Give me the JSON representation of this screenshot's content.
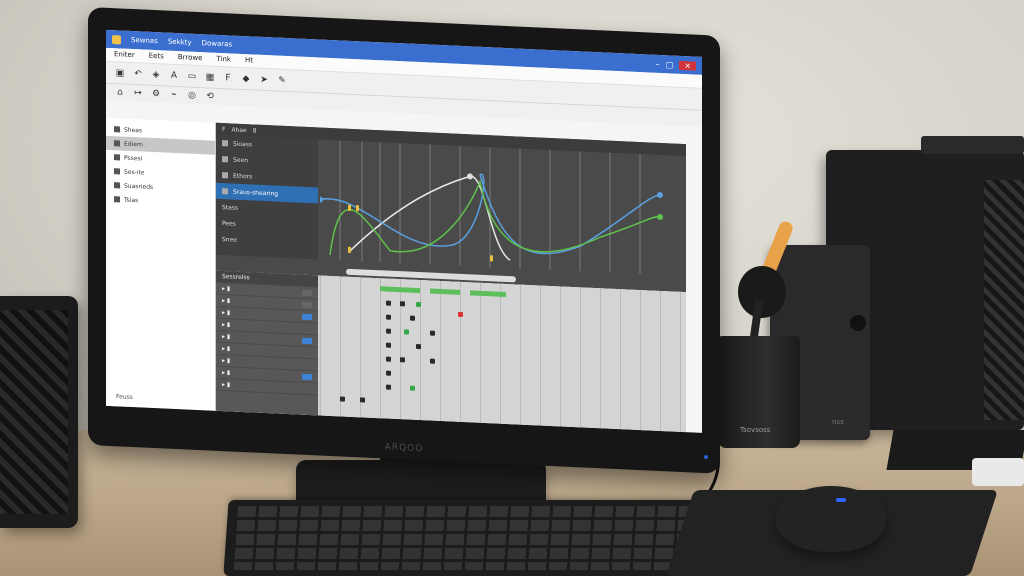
{
  "app": {
    "title_items": [
      "Sewnas",
      "Sekkty",
      "Dowaras"
    ],
    "menu": [
      "Eniter",
      "Eets",
      "Brrowe",
      "Tink",
      "Ht"
    ],
    "graph_header": [
      "F",
      "Ahae",
      "8"
    ],
    "graph_items": [
      "Sioass",
      "Seen",
      "Ethors",
      "Sraus-shearing",
      "Stass",
      "Pees",
      "Snee"
    ],
    "left_items": [
      "Sheas",
      "Ediem",
      "Pssesi",
      "Ses-ite",
      "Suasrieds",
      "Tsias"
    ],
    "left_footer": "Feuss",
    "dope_header": "Sessrelss",
    "dope_rows": 10
  },
  "monitor": {
    "brand": "ARQOO"
  },
  "mic_cup_label": "Tsovsoss",
  "box_speaker_label": "nss"
}
